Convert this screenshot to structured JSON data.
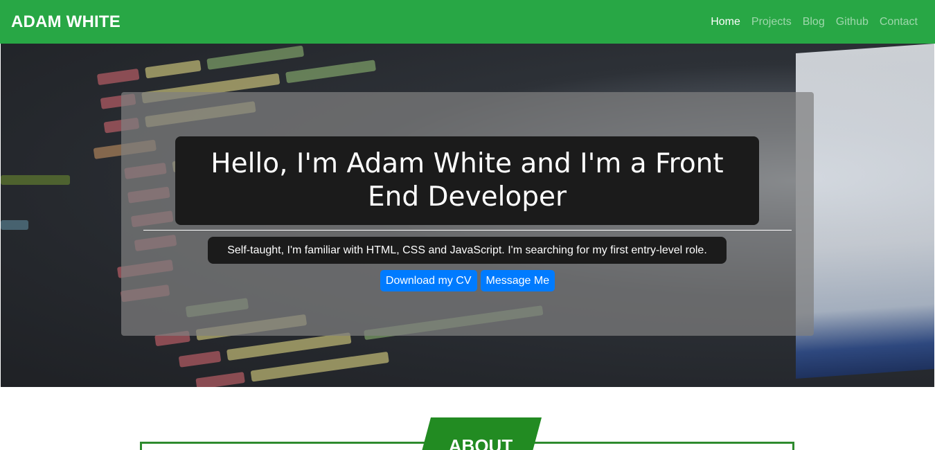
{
  "navbar": {
    "brand": "ADAM WHITE",
    "links": [
      "Home",
      "Projects",
      "Blog",
      "Github",
      "Contact"
    ],
    "active": "Home",
    "background": "#28a745"
  },
  "hero": {
    "title": "Hello, I'm Adam White and I'm a Front End Developer",
    "subtitle": "Self-taught, I'm familiar with HTML, CSS and JavaScript. I'm searching for my first entry-level role.",
    "buttons": {
      "download_cv": "Download my CV",
      "message_me": "Message Me"
    },
    "button_color": "#007bff"
  },
  "about": {
    "label": "ABOUT",
    "accent": "#228b22"
  }
}
